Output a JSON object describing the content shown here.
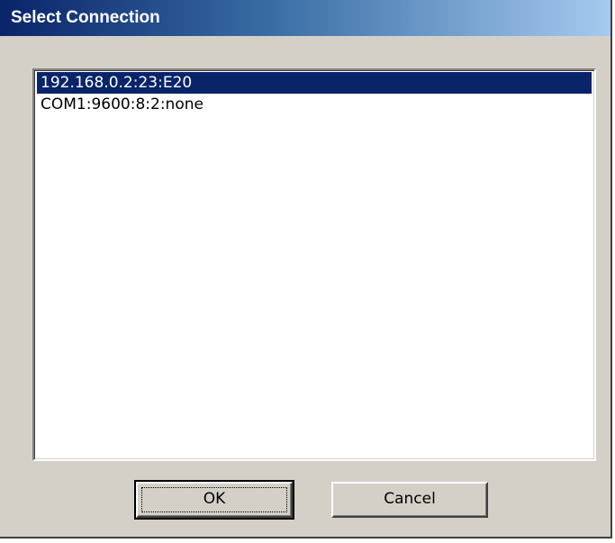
{
  "dialog": {
    "title": "Select Connection"
  },
  "connections": {
    "items": [
      {
        "label": "192.168.0.2:23:E20",
        "selected": true
      },
      {
        "label": "COM1:9600:8:2:none",
        "selected": false
      }
    ]
  },
  "buttons": {
    "ok_label": "OK",
    "cancel_label": "Cancel"
  },
  "colors": {
    "dialog_background": "#d4d0c8",
    "titlebar_start": "#0a246a",
    "titlebar_end": "#a6caf0",
    "selection_background": "#0a246a",
    "selection_text": "#ffffff"
  }
}
